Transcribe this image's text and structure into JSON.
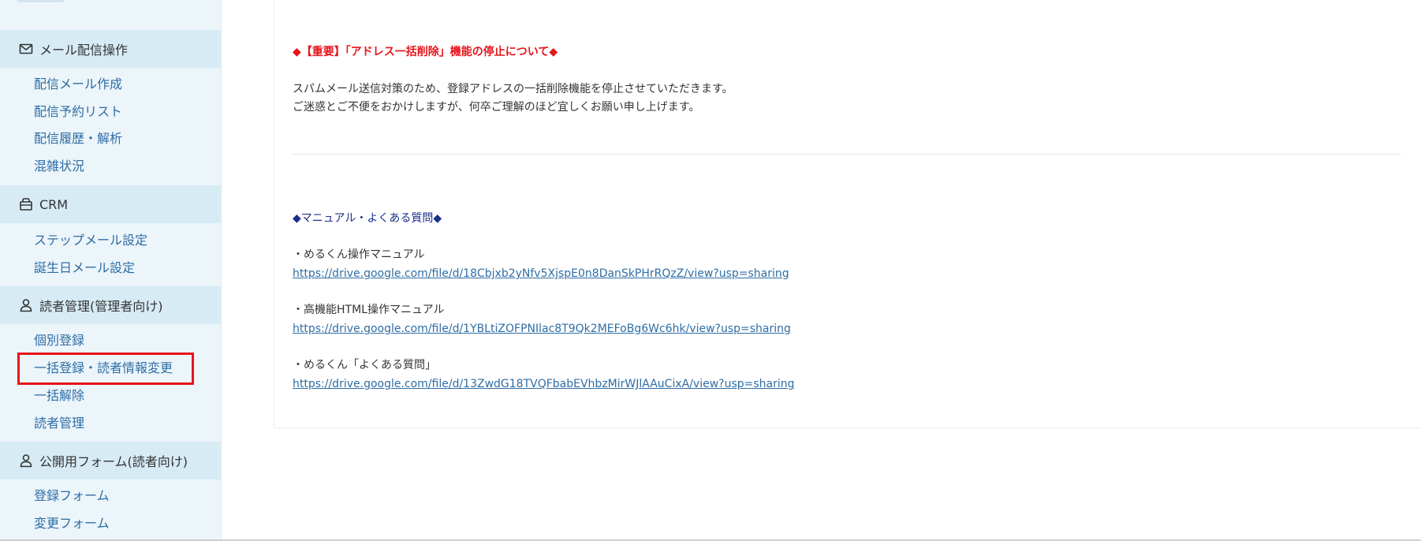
{
  "sidebar": {
    "sections": [
      {
        "title": "メール配信操作",
        "icon": "mail-icon",
        "items": [
          "配信メール作成",
          "配信予約リスト",
          "配信履歴・解析",
          "混雑状況"
        ]
      },
      {
        "title": "CRM",
        "icon": "crm-icon",
        "items": [
          "ステップメール設定",
          "誕生日メール設定"
        ]
      },
      {
        "title": "読者管理(管理者向け)",
        "icon": "user-icon",
        "items": [
          "個別登録",
          "一括登録・読者情報変更",
          "一括解除",
          "読者管理"
        ]
      },
      {
        "title": "公開用フォーム(読者向け)",
        "icon": "user-icon",
        "items": [
          "登録フォーム",
          "変更フォーム"
        ]
      }
    ]
  },
  "notice": {
    "title": "◆【重要】「アドレス一括削除」機能の停止について◆",
    "line1": "スパムメール送信対策のため、登録アドレスの一括削除機能を停止させていただきます。",
    "line2": "ご迷惑とご不便をおかけしますが、何卒ご理解のほど宜しくお願い申し上げます。"
  },
  "manual": {
    "title": "◆マニュアル・よくある質問◆",
    "items": [
      {
        "label": "・めるくん操作マニュアル",
        "url": "https://drive.google.com/file/d/18Cbjxb2yNfv5XjspE0n8DanSkPHrRQzZ/view?usp=sharing"
      },
      {
        "label": "・高機能HTML操作マニュアル",
        "url": "https://drive.google.com/file/d/1YBLtiZOFPNIlac8T9Qk2MEFoBg6Wc6hk/view?usp=sharing"
      },
      {
        "label": "・めるくん「よくある質問」",
        "url": "https://drive.google.com/file/d/13ZwdG18TVQFbabEVhbzMirWJlAAuCixA/view?usp=sharing"
      }
    ]
  },
  "colors": {
    "accent_red": "#e8141b",
    "link_blue": "#2e6da4",
    "sidebar_bg": "#ecf5fa",
    "section_bg": "#d7ebf5",
    "manual_navy": "#1a2e8a"
  }
}
